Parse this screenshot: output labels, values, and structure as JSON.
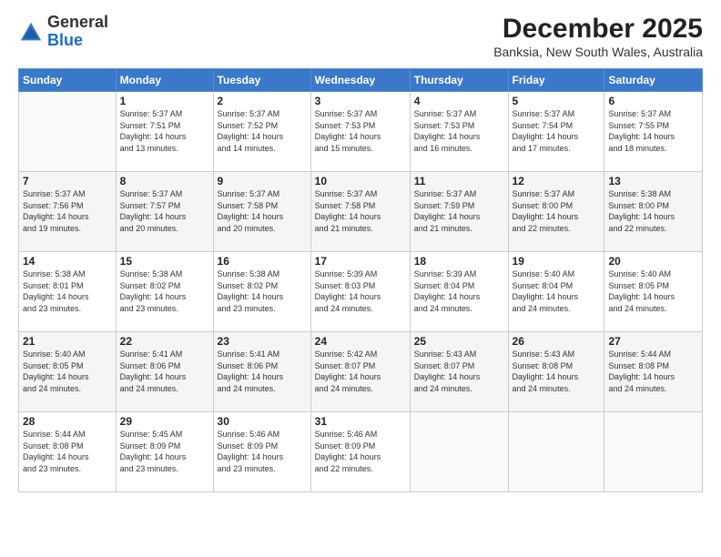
{
  "header": {
    "logo_general": "General",
    "logo_blue": "Blue",
    "title": "December 2025",
    "subtitle": "Banksia, New South Wales, Australia"
  },
  "weekdays": [
    "Sunday",
    "Monday",
    "Tuesday",
    "Wednesday",
    "Thursday",
    "Friday",
    "Saturday"
  ],
  "weeks": [
    [
      {
        "day": "",
        "info": ""
      },
      {
        "day": "1",
        "info": "Sunrise: 5:37 AM\nSunset: 7:51 PM\nDaylight: 14 hours\nand 13 minutes."
      },
      {
        "day": "2",
        "info": "Sunrise: 5:37 AM\nSunset: 7:52 PM\nDaylight: 14 hours\nand 14 minutes."
      },
      {
        "day": "3",
        "info": "Sunrise: 5:37 AM\nSunset: 7:53 PM\nDaylight: 14 hours\nand 15 minutes."
      },
      {
        "day": "4",
        "info": "Sunrise: 5:37 AM\nSunset: 7:53 PM\nDaylight: 14 hours\nand 16 minutes."
      },
      {
        "day": "5",
        "info": "Sunrise: 5:37 AM\nSunset: 7:54 PM\nDaylight: 14 hours\nand 17 minutes."
      },
      {
        "day": "6",
        "info": "Sunrise: 5:37 AM\nSunset: 7:55 PM\nDaylight: 14 hours\nand 18 minutes."
      }
    ],
    [
      {
        "day": "7",
        "info": "Sunrise: 5:37 AM\nSunset: 7:56 PM\nDaylight: 14 hours\nand 19 minutes."
      },
      {
        "day": "8",
        "info": "Sunrise: 5:37 AM\nSunset: 7:57 PM\nDaylight: 14 hours\nand 20 minutes."
      },
      {
        "day": "9",
        "info": "Sunrise: 5:37 AM\nSunset: 7:58 PM\nDaylight: 14 hours\nand 20 minutes."
      },
      {
        "day": "10",
        "info": "Sunrise: 5:37 AM\nSunset: 7:58 PM\nDaylight: 14 hours\nand 21 minutes."
      },
      {
        "day": "11",
        "info": "Sunrise: 5:37 AM\nSunset: 7:59 PM\nDaylight: 14 hours\nand 21 minutes."
      },
      {
        "day": "12",
        "info": "Sunrise: 5:37 AM\nSunset: 8:00 PM\nDaylight: 14 hours\nand 22 minutes."
      },
      {
        "day": "13",
        "info": "Sunrise: 5:38 AM\nSunset: 8:00 PM\nDaylight: 14 hours\nand 22 minutes."
      }
    ],
    [
      {
        "day": "14",
        "info": "Sunrise: 5:38 AM\nSunset: 8:01 PM\nDaylight: 14 hours\nand 23 minutes."
      },
      {
        "day": "15",
        "info": "Sunrise: 5:38 AM\nSunset: 8:02 PM\nDaylight: 14 hours\nand 23 minutes."
      },
      {
        "day": "16",
        "info": "Sunrise: 5:38 AM\nSunset: 8:02 PM\nDaylight: 14 hours\nand 23 minutes."
      },
      {
        "day": "17",
        "info": "Sunrise: 5:39 AM\nSunset: 8:03 PM\nDaylight: 14 hours\nand 24 minutes."
      },
      {
        "day": "18",
        "info": "Sunrise: 5:39 AM\nSunset: 8:04 PM\nDaylight: 14 hours\nand 24 minutes."
      },
      {
        "day": "19",
        "info": "Sunrise: 5:40 AM\nSunset: 8:04 PM\nDaylight: 14 hours\nand 24 minutes."
      },
      {
        "day": "20",
        "info": "Sunrise: 5:40 AM\nSunset: 8:05 PM\nDaylight: 14 hours\nand 24 minutes."
      }
    ],
    [
      {
        "day": "21",
        "info": "Sunrise: 5:40 AM\nSunset: 8:05 PM\nDaylight: 14 hours\nand 24 minutes."
      },
      {
        "day": "22",
        "info": "Sunrise: 5:41 AM\nSunset: 8:06 PM\nDaylight: 14 hours\nand 24 minutes."
      },
      {
        "day": "23",
        "info": "Sunrise: 5:41 AM\nSunset: 8:06 PM\nDaylight: 14 hours\nand 24 minutes."
      },
      {
        "day": "24",
        "info": "Sunrise: 5:42 AM\nSunset: 8:07 PM\nDaylight: 14 hours\nand 24 minutes."
      },
      {
        "day": "25",
        "info": "Sunrise: 5:43 AM\nSunset: 8:07 PM\nDaylight: 14 hours\nand 24 minutes."
      },
      {
        "day": "26",
        "info": "Sunrise: 5:43 AM\nSunset: 8:08 PM\nDaylight: 14 hours\nand 24 minutes."
      },
      {
        "day": "27",
        "info": "Sunrise: 5:44 AM\nSunset: 8:08 PM\nDaylight: 14 hours\nand 24 minutes."
      }
    ],
    [
      {
        "day": "28",
        "info": "Sunrise: 5:44 AM\nSunset: 8:08 PM\nDaylight: 14 hours\nand 23 minutes."
      },
      {
        "day": "29",
        "info": "Sunrise: 5:45 AM\nSunset: 8:09 PM\nDaylight: 14 hours\nand 23 minutes."
      },
      {
        "day": "30",
        "info": "Sunrise: 5:46 AM\nSunset: 8:09 PM\nDaylight: 14 hours\nand 23 minutes."
      },
      {
        "day": "31",
        "info": "Sunrise: 5:46 AM\nSunset: 8:09 PM\nDaylight: 14 hours\nand 22 minutes."
      },
      {
        "day": "",
        "info": ""
      },
      {
        "day": "",
        "info": ""
      },
      {
        "day": "",
        "info": ""
      }
    ]
  ]
}
